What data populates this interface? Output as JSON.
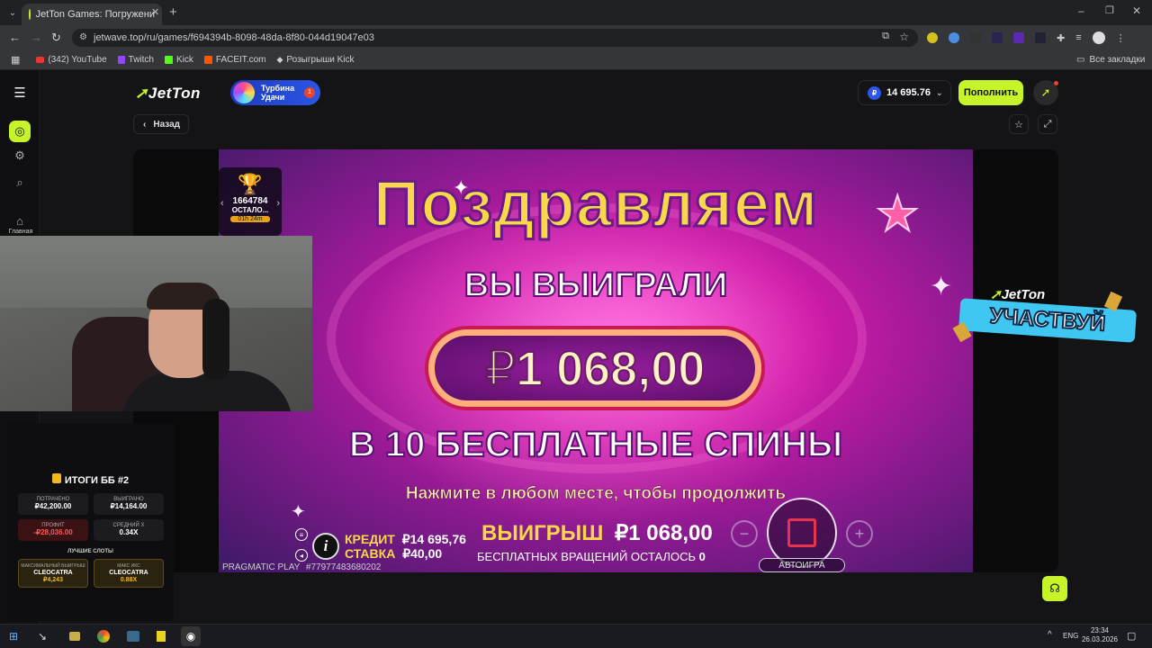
{
  "browser": {
    "tab_title": "JetTon Games: Погружени",
    "url": "jetwave.top/ru/games/f694394b-8098-48da-8f80-044d19047e03",
    "bookmarks": [
      "(342) YouTube",
      "Twitch",
      "Kick",
      "FACEIT.com",
      "Розыгрыши Kick"
    ],
    "all_bookmarks": "Все закладки"
  },
  "site": {
    "logo": "JetTon",
    "turbo_label": "Турбина Удачи",
    "turbo_badge": "1",
    "balance": "14 695.76",
    "currency_symbol": "₽",
    "topup": "Пополнить",
    "back": "Назад",
    "home_label": "Главная"
  },
  "game": {
    "tournament_value": "1664784",
    "tournament_caption": "ОСТАЛО...",
    "tournament_time": "01h 24m",
    "congrats": "Поздравляем",
    "you_won": "ВЫ ВЫИГРАЛИ",
    "amount": "₽1 068,00",
    "free_spins": "В 10 БЕСПЛАТНЫЕ СПИНЫ",
    "press_hint": "Нажмите в любом месте, чтобы продолжить",
    "credit_label": "КРЕДИТ",
    "credit_value": "₽14 695,76",
    "bet_label": "СТАВКА",
    "bet_value": "₽40,00",
    "win_label": "ВЫИГРЫШ",
    "win_value": "₽1 068,00",
    "fs_left_label": "БЕСПЛАТНЫХ ВРАЩЕНИЙ ОСТАЛОСЬ",
    "fs_left_value": "0",
    "provider": "PRAGMATIC PLAY",
    "round_id": "#77977483680202",
    "autoplay": "АВТОИГРА"
  },
  "overlay": {
    "title": "ИТОГИ ББ #2",
    "spent_label": "ПОТРАЧЕНО",
    "spent_value": "₽42,200.00",
    "won_label": "ВЫИГРАНО",
    "won_value": "₽14,164.00",
    "profit_label": "ПРОФИТ",
    "profit_value": "-₽28,036.00",
    "avg_label": "СРЕДНИЙ Х",
    "avg_value": "0.34X",
    "best_slots": "ЛУЧШИЕ СЛОТЫ",
    "max_win_label": "МАКСИМАЛЬНЫЙ ВЫИГРЫШ",
    "max_win_slot": "CLEOCATRA",
    "max_win_value": "₽4,243",
    "max_x_label": "МАКС ИКС",
    "max_x_slot": "CLEOCATRA",
    "max_x_value": "0.88X"
  },
  "promo": {
    "logo": "JetTon",
    "text": "УЧАСТВУЙ"
  },
  "taskbar": {
    "lang": "ENG",
    "time": "23:34",
    "date": "26.03.2026"
  },
  "colors": {
    "accent": "#c6f32a",
    "brand_blue": "#2b56e6",
    "gold": "#f8d74a",
    "magenta": "#d11ba8"
  }
}
